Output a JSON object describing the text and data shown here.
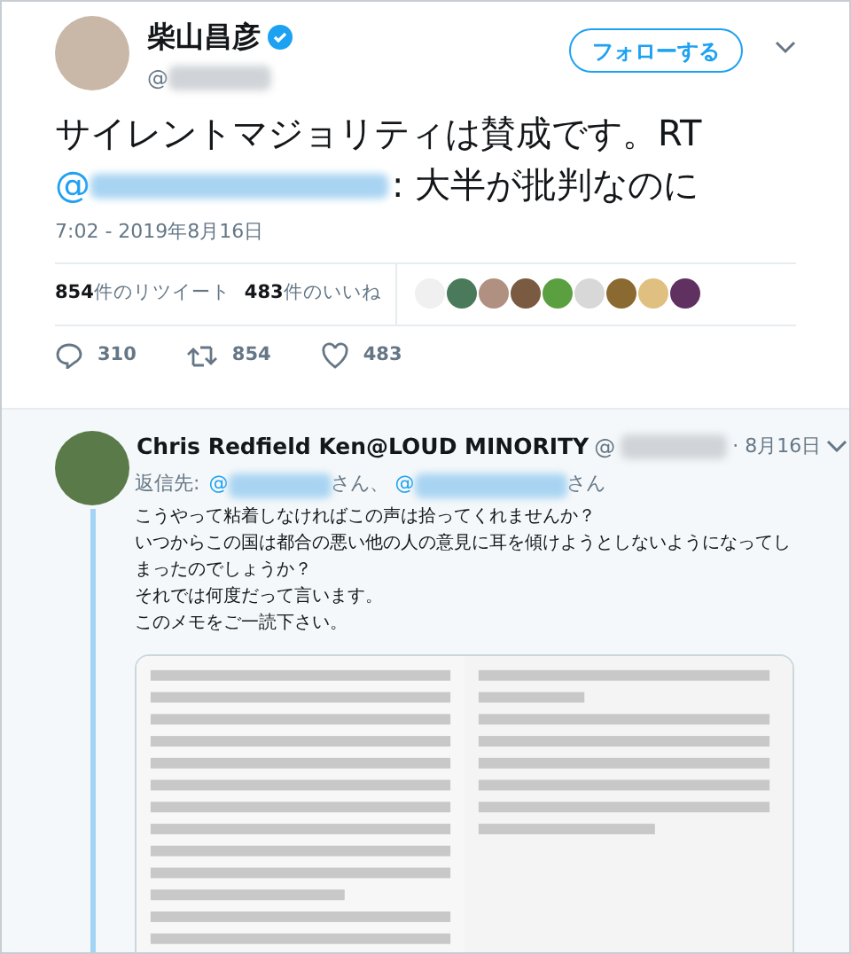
{
  "tweet": {
    "author": {
      "name": "柴山昌彦",
      "verified": true,
      "handle_prefix": "@"
    },
    "follow_button": "フォローする",
    "text_line1": "サイレントマジョリティは賛成です。RT",
    "mention_prefix": "@",
    "text_rest": ": 大半が批判なのに",
    "time": "7:02 - 2019年8月16日",
    "retweets": {
      "count": "854",
      "label": "件のリツイート"
    },
    "likes": {
      "count": "483",
      "label": "件のいいね"
    },
    "likers": [
      {
        "color": "#f0f0f0"
      },
      {
        "color": "#4a7a5a"
      },
      {
        "color": "#b09080"
      },
      {
        "color": "#7a5a40"
      },
      {
        "color": "#5aa040"
      },
      {
        "color": "#d8d8d8"
      },
      {
        "color": "#8a6a30"
      },
      {
        "color": "#e0c080"
      },
      {
        "color": "#603060"
      }
    ],
    "actions": [
      {
        "kind": "reply",
        "count": "310"
      },
      {
        "kind": "retweet",
        "count": "854"
      },
      {
        "kind": "like",
        "count": "483"
      }
    ]
  },
  "reply": {
    "name": "Chris Redfield Ken@LOUD MINORITY",
    "handle_prefix": "@",
    "date": "· 8月16日",
    "reply_to_label": "返信先:",
    "reply_to": [
      {
        "prefix": "@",
        "suffix": "さん、"
      },
      {
        "prefix": "@",
        "suffix": "さん"
      }
    ],
    "lines": [
      "こうやって粘着しなければこの声は拾ってくれませんか？",
      "いつからこの国は都合の悪い他の人の意見に耳を傾けようとしないようになってしまったのでしょうか？",
      "それでは何度だって言います。",
      "このメモをご一読下さい。"
    ]
  }
}
